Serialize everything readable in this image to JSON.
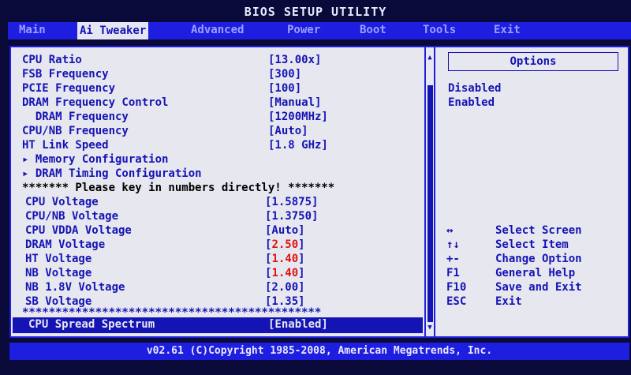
{
  "window": {
    "title": "BIOS SETUP UTILITY"
  },
  "menu": {
    "items": [
      {
        "label": "Main"
      },
      {
        "label": "Ai Tweaker"
      },
      {
        "label": "Advanced"
      },
      {
        "label": "Power"
      },
      {
        "label": "Boot"
      },
      {
        "label": "Tools"
      },
      {
        "label": "Exit"
      }
    ],
    "active": "Ai Tweaker"
  },
  "settings": [
    {
      "label": "CPU Ratio",
      "value": "[13.00x]"
    },
    {
      "label": "FSB Frequency",
      "value": "[300]"
    },
    {
      "label": "PCIE Frequency",
      "value": "[100]"
    },
    {
      "label": "DRAM Frequency Control",
      "value": "[Manual]"
    },
    {
      "label": "  DRAM Frequency",
      "value": "[1200MHz]"
    },
    {
      "label": "CPU/NB Frequency",
      "value": "[Auto]"
    },
    {
      "label": "HT Link Speed",
      "value": "[1.8 GHz]"
    }
  ],
  "submenus": [
    {
      "label": "Memory Configuration"
    },
    {
      "label": "DRAM Timing Configuration"
    }
  ],
  "note": "******* Please key in numbers directly! *******",
  "voltages": [
    {
      "label": "CPU Voltage",
      "value": "[1.5875]"
    },
    {
      "label": "CPU/NB Voltage",
      "value": "[1.3750]"
    },
    {
      "label": "CPU VDDA Voltage",
      "value": "[Auto]"
    },
    {
      "label": "DRAM Voltage",
      "value_open": "[",
      "value_num": "2.50",
      "value_close": "]"
    },
    {
      "label": "HT Voltage",
      "value_open": "[",
      "value_num": "1.40",
      "value_close": "]"
    },
    {
      "label": "NB Voltage",
      "value_open": "[",
      "value_num": "1.40",
      "value_close": "]"
    },
    {
      "label": "NB 1.8V Voltage",
      "value": "[2.00]"
    },
    {
      "label": "SB Voltage",
      "value": "[1.35]"
    }
  ],
  "separator": "*********************************************",
  "selected": {
    "label": "CPU Spread Spectrum",
    "value": "[Enabled]"
  },
  "options": {
    "title": "Options",
    "items": [
      "Disabled",
      "Enabled"
    ]
  },
  "help": [
    {
      "key": "↔",
      "desc": "Select Screen"
    },
    {
      "key": "↑↓",
      "desc": "Select Item"
    },
    {
      "key": "+-",
      "desc": "Change Option"
    },
    {
      "key": "F1",
      "desc": "General Help"
    },
    {
      "key": "F10",
      "desc": "Save and Exit"
    },
    {
      "key": "ESC",
      "desc": "Exit"
    }
  ],
  "footer": "v02.61 (C)Copyright 1985-2008, American Megatrends, Inc.",
  "colors": {
    "background": "#0a0a3a",
    "menubar": "#1e1ee0",
    "panel": "#e7e7f0",
    "text": "#1414b4",
    "warning_value": "#e01414"
  }
}
